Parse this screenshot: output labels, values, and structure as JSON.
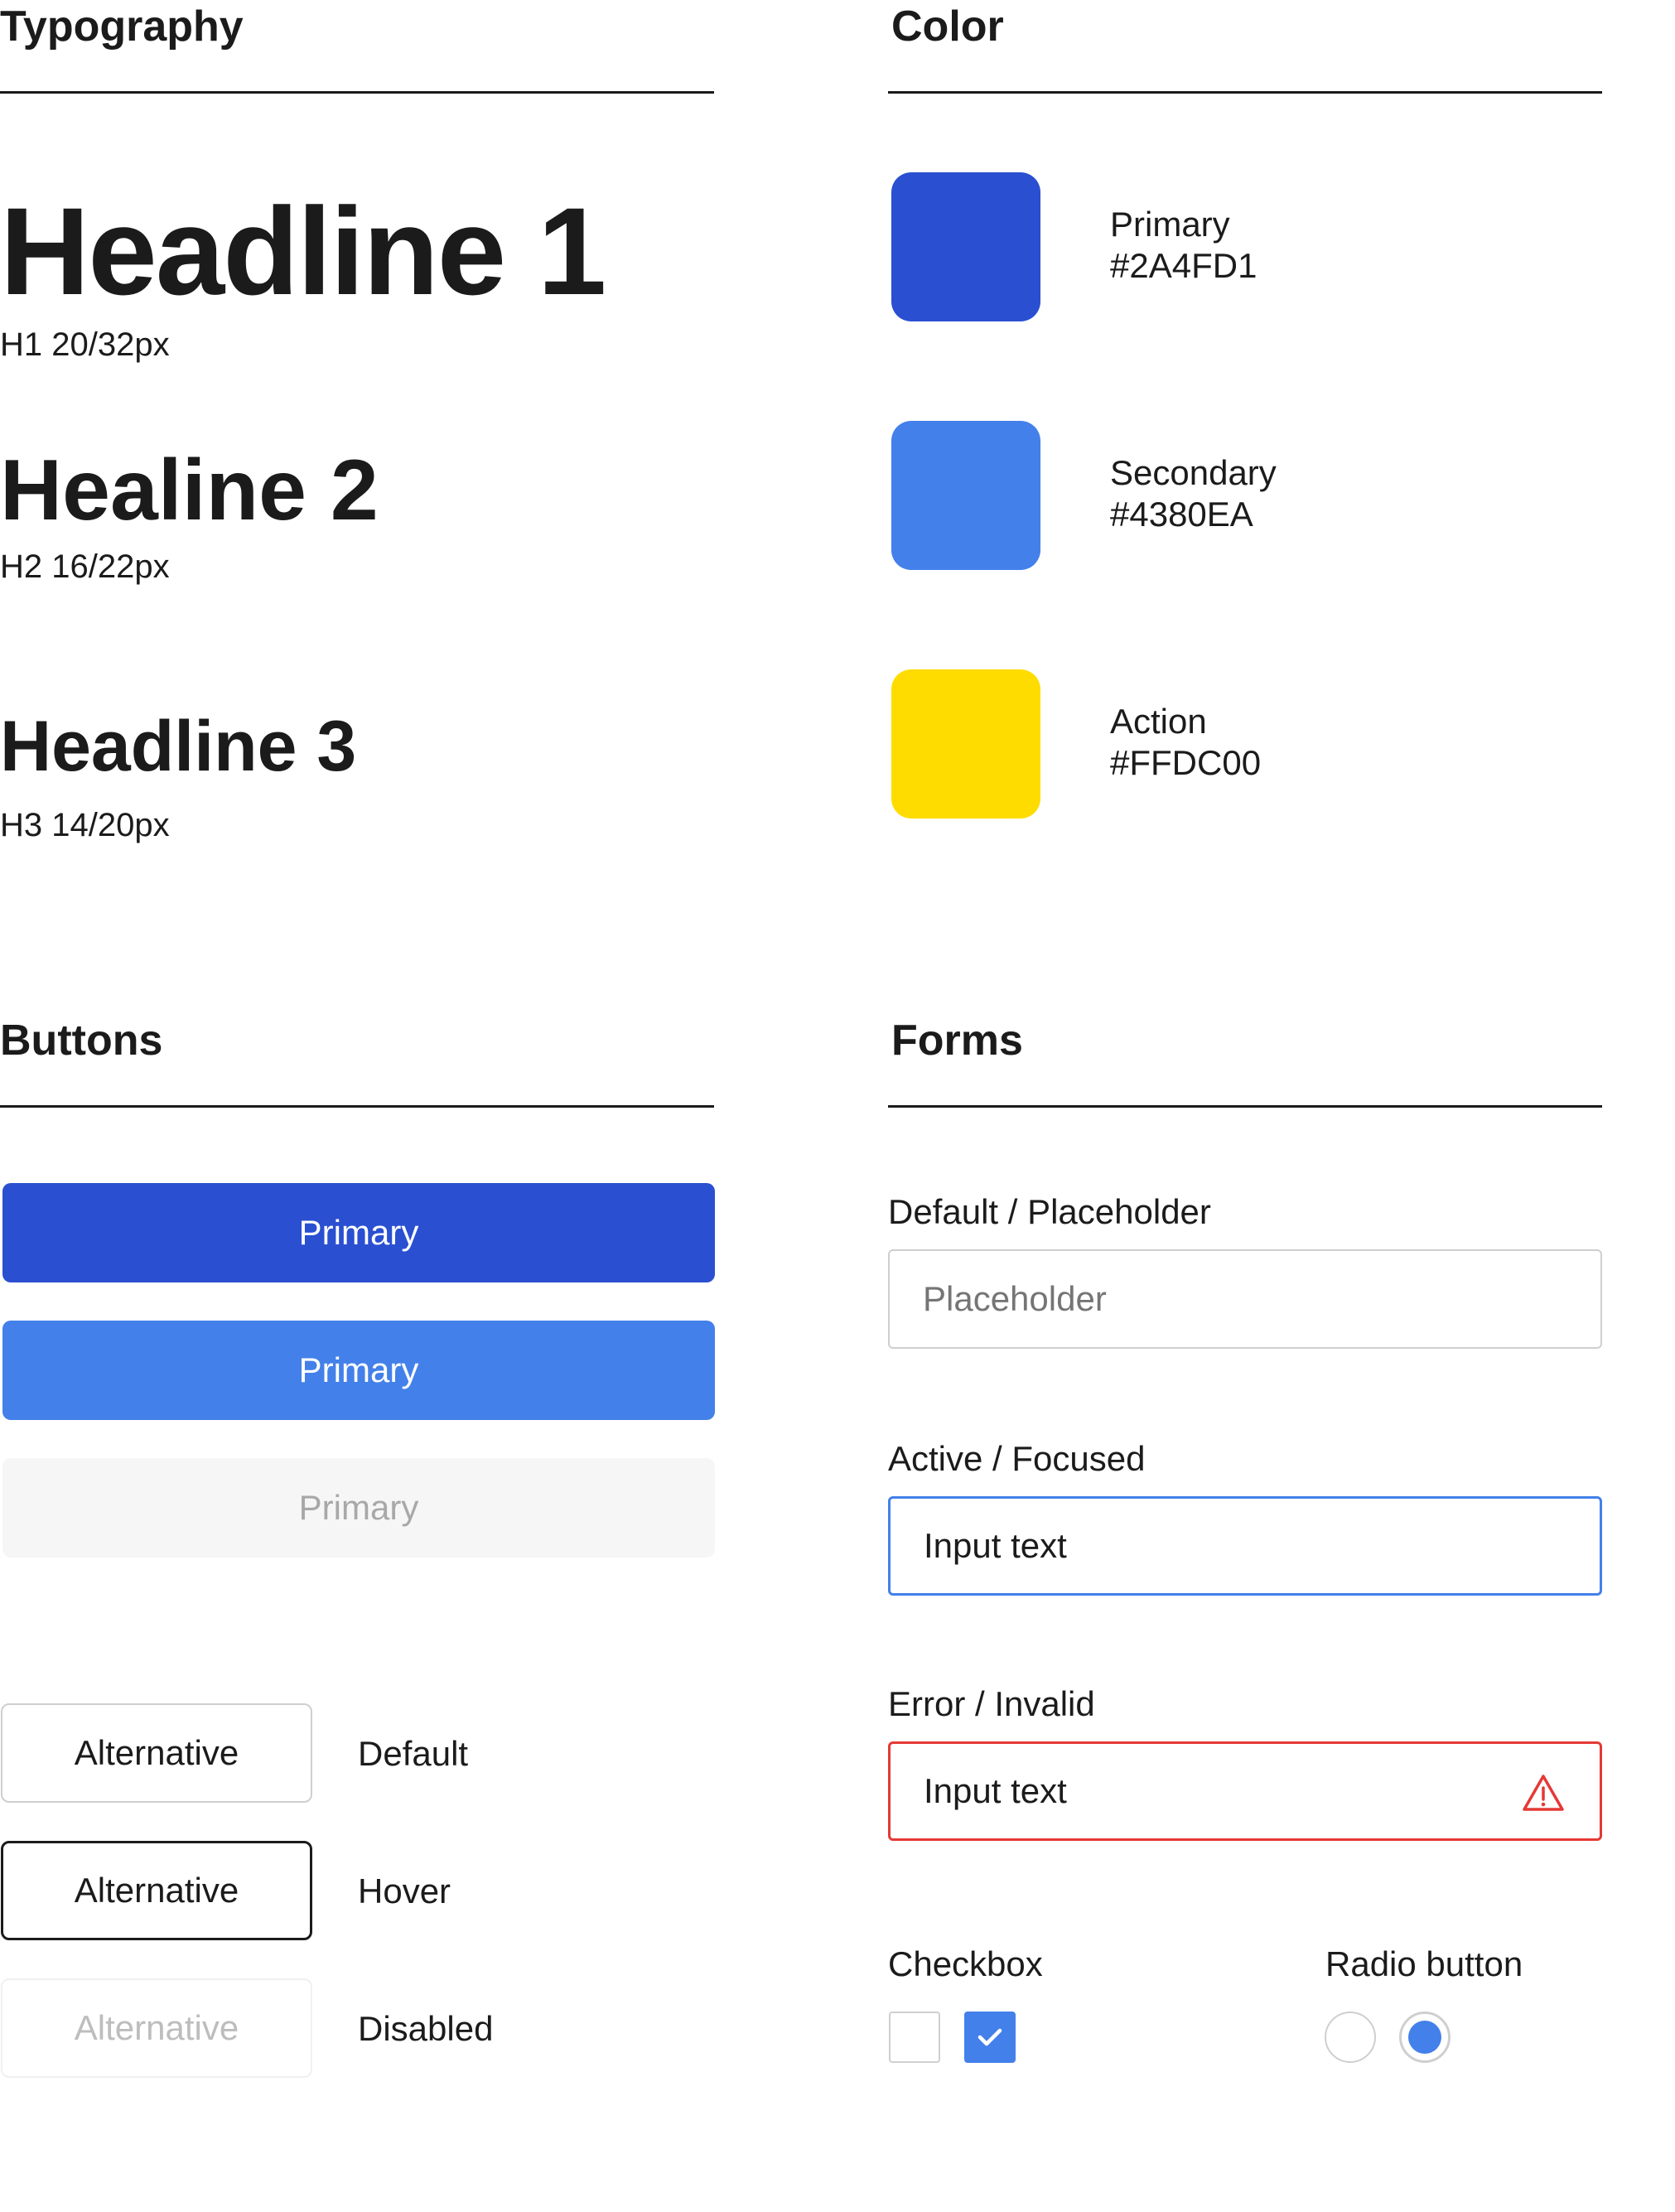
{
  "typography": {
    "title": "Typography",
    "h1": {
      "text": "Headline 1",
      "spec": "H1 20/32px"
    },
    "h2": {
      "text": "Healine 2",
      "spec": "H2 16/22px"
    },
    "h3": {
      "text": "Headline 3",
      "spec": "H3 14/20px"
    }
  },
  "color": {
    "title": "Color",
    "swatches": [
      {
        "name": "Primary",
        "hex": "#2A4FD1"
      },
      {
        "name": "Secondary",
        "hex": "#4380EA"
      },
      {
        "name": "Action",
        "hex": "#FFDC00"
      }
    ]
  },
  "buttons": {
    "title": "Buttons",
    "primary_default": "Primary",
    "primary_hover": "Primary",
    "primary_disabled": "Primary",
    "alternative": [
      {
        "label": "Alternative",
        "state": "Default"
      },
      {
        "label": "Alternative",
        "state": "Hover"
      },
      {
        "label": "Alternative",
        "state": "Disabled"
      }
    ]
  },
  "forms": {
    "title": "Forms",
    "default_label": "Default / Placeholder",
    "default_placeholder": "Placeholder",
    "active_label": "Active / Focused",
    "active_value": "Input text",
    "error_label": "Error / Invalid",
    "error_value": "Input text",
    "checkbox_label": "Checkbox",
    "radio_label": "Radio button",
    "checkbox_states": [
      false,
      true
    ],
    "radio_states": [
      false,
      true
    ]
  },
  "colors": {
    "text": "#1b1b1b",
    "primary": "#2A4FD1",
    "secondary": "#4380EA",
    "action": "#FFDC00",
    "error": "#E53935",
    "disabled_bg": "#F6F6F6",
    "disabled_text": "#A8A8A8"
  },
  "icons": {
    "error": "warning-triangle-icon",
    "check": "checkmark-icon"
  }
}
